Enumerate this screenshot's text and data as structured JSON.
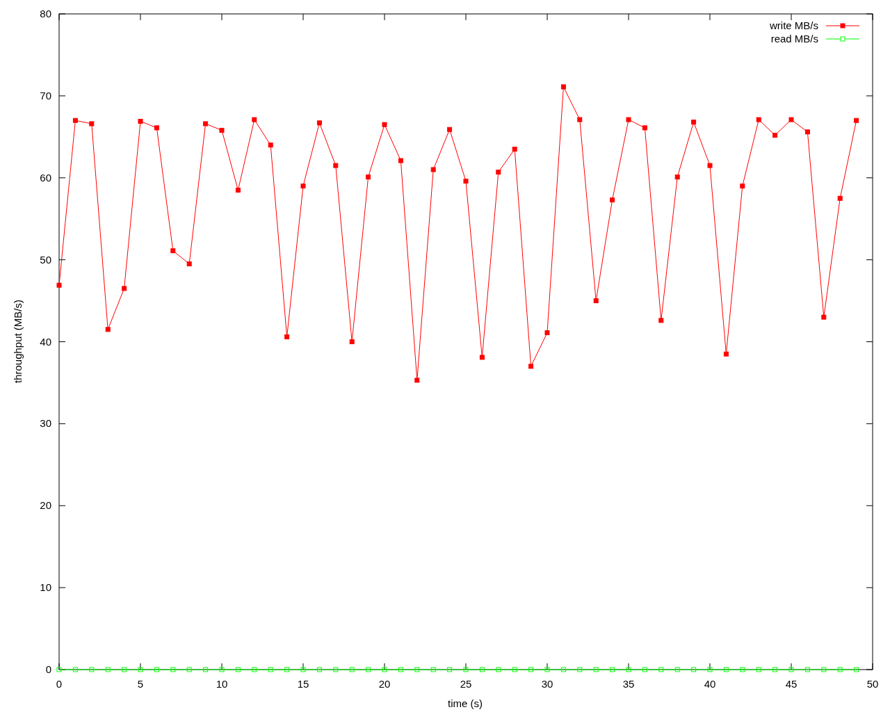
{
  "chart_data": {
    "type": "line",
    "xlabel": "time (s)",
    "ylabel": "throughput (MB/s)",
    "x": [
      0,
      1,
      2,
      3,
      4,
      5,
      6,
      7,
      8,
      9,
      10,
      11,
      12,
      13,
      14,
      15,
      16,
      17,
      18,
      19,
      20,
      21,
      22,
      23,
      24,
      25,
      26,
      27,
      28,
      29,
      30,
      31,
      32,
      33,
      34,
      35,
      36,
      37,
      38,
      39,
      40,
      41,
      42,
      43,
      44,
      45,
      46,
      47,
      48,
      49
    ],
    "series": [
      {
        "name": "write MB/s",
        "color": "#ff0000",
        "marker": "square",
        "values": [
          46.9,
          67.0,
          66.6,
          41.5,
          46.5,
          66.9,
          66.1,
          51.1,
          49.5,
          66.6,
          65.8,
          58.5,
          67.1,
          64.0,
          40.6,
          59.0,
          66.7,
          61.5,
          40.0,
          60.1,
          66.5,
          62.1,
          35.3,
          61.0,
          65.9,
          59.6,
          38.1,
          60.7,
          63.5,
          37.0,
          41.1,
          71.1,
          67.1,
          45.0,
          57.3,
          67.1,
          66.1,
          42.6,
          60.1,
          66.8,
          61.5,
          38.5,
          59.0,
          67.1,
          65.2,
          67.1,
          65.6,
          43.0,
          57.5,
          67.0
        ]
      },
      {
        "name": "read MB/s",
        "color": "#00ff00",
        "marker": "square",
        "values": [
          0,
          0,
          0,
          0,
          0,
          0,
          0,
          0,
          0,
          0,
          0,
          0,
          0,
          0,
          0,
          0,
          0,
          0,
          0,
          0,
          0,
          0,
          0,
          0,
          0,
          0,
          0,
          0,
          0,
          0,
          0,
          0,
          0,
          0,
          0,
          0,
          0,
          0,
          0,
          0,
          0,
          0,
          0,
          0,
          0,
          0,
          0,
          0,
          0,
          0
        ]
      }
    ],
    "legend": true,
    "xlim": [
      0,
      50
    ],
    "ylim": [
      0,
      80
    ],
    "xticks": [
      0,
      5,
      10,
      15,
      20,
      25,
      30,
      35,
      40,
      45,
      50
    ],
    "yticks": [
      0,
      10,
      20,
      30,
      40,
      50,
      60,
      70,
      80
    ]
  }
}
